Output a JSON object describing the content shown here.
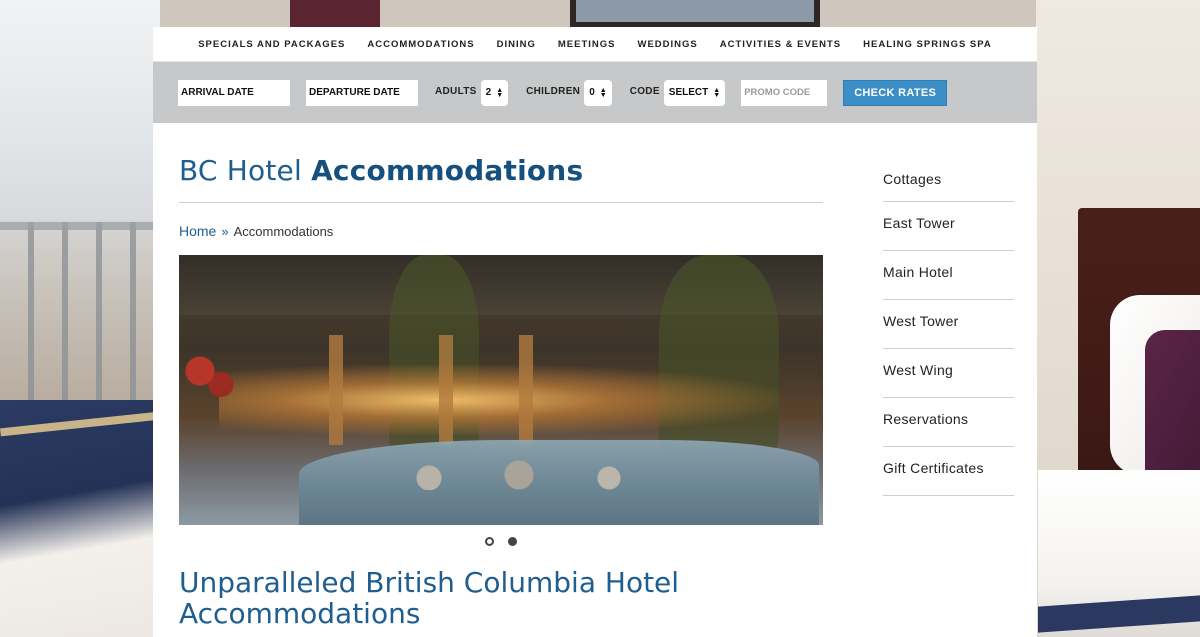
{
  "nav": {
    "items": [
      "SPECIALS AND PACKAGES",
      "ACCOMMODATIONS",
      "DINING",
      "MEETINGS",
      "WEDDINGS",
      "ACTIVITIES & EVENTS",
      "HEALING SPRINGS SPA"
    ]
  },
  "booking": {
    "arrival_placeholder": "ARRIVAL DATE",
    "departure_placeholder": "DEPARTURE DATE",
    "adults_label": "ADULTS",
    "adults_value": "2",
    "children_label": "CHILDREN",
    "children_value": "0",
    "code_label": "CODE",
    "code_value": "SELECT",
    "promo_placeholder": "PROMO CODE",
    "check_rates_label": "CHECK RATES"
  },
  "page": {
    "title_light": "BC Hotel",
    "title_bold": "Accommodations",
    "breadcrumb_home": "Home",
    "breadcrumb_sep": "»",
    "breadcrumb_current": "Accommodations",
    "section_title": "Unparalleled British Columbia Hotel Accommodations"
  },
  "slider": {
    "slide_count": 2,
    "active_slide": 1
  },
  "sidebar": {
    "items": [
      "Cottages",
      "East Tower",
      "Main Hotel",
      "West Tower",
      "West Wing",
      "Reservations",
      "Gift Certificates"
    ]
  },
  "colors": {
    "brand_blue": "#1f5e90",
    "button_blue": "#3b8ec6",
    "booking_bar": "#c6c8c9"
  }
}
